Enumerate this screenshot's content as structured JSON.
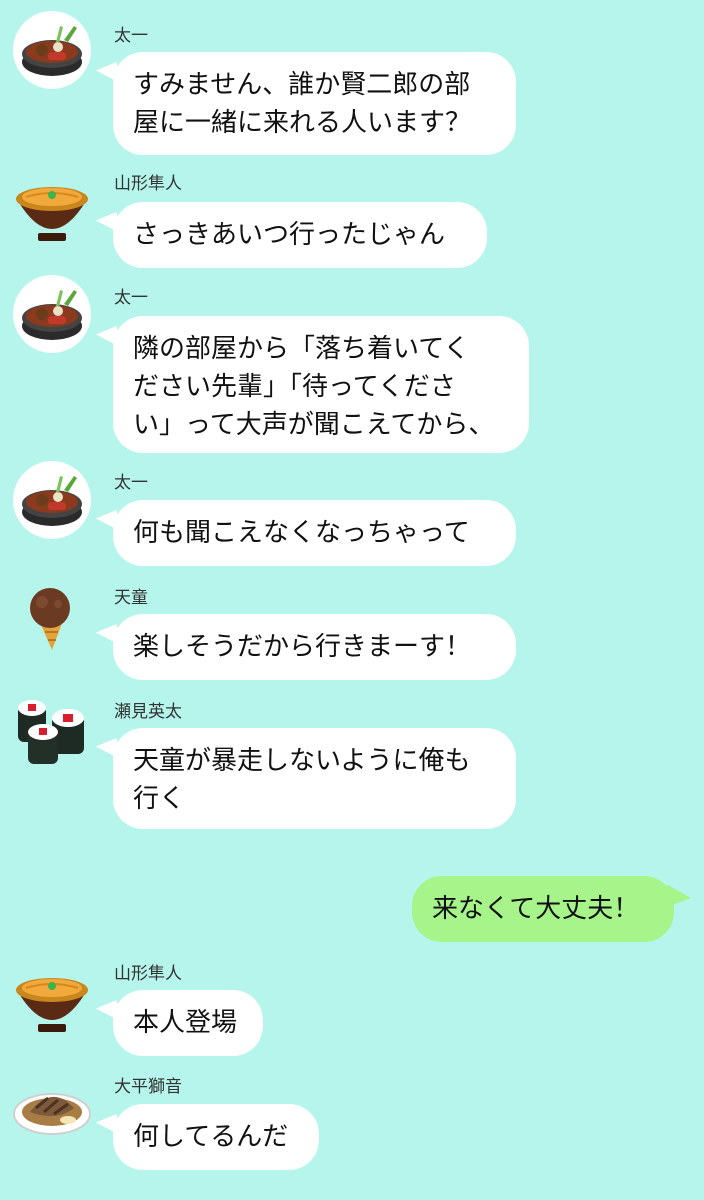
{
  "chat": {
    "m1": {
      "sender": "太一",
      "avatar": "sukiyaki-pot-icon",
      "text": "すみません、誰か賢二郎の部\n屋に一緒に来れる人います？"
    },
    "m2": {
      "sender": "山形隼人",
      "avatar": "uni-don-icon",
      "text": "さっきあいつ行ったじゃん"
    },
    "m3": {
      "sender": "太一",
      "avatar": "sukiyaki-pot-icon",
      "text": "隣の部屋から「落ち着いてく\nださい先輩」「待ってくださ\nい」って大声が聞こえてから、"
    },
    "m4": {
      "sender": "太一",
      "avatar": "sukiyaki-pot-icon",
      "text": "何も聞こえなくなっちゃって"
    },
    "m5": {
      "sender": "天童",
      "avatar": "chocolate-ice-cream-cone-icon",
      "text": "楽しそうだから行きまーす！"
    },
    "m6": {
      "sender": "瀬見英太",
      "avatar": "tekka-maki-icon",
      "text": "天童が暴走しないように俺も\n行く"
    },
    "m7": {
      "sender": "",
      "avatar": "",
      "text": "来なくて大丈夫！"
    },
    "m8": {
      "sender": "山形隼人",
      "avatar": "uni-don-icon",
      "text": "本人登場"
    },
    "m9": {
      "sender": "大平獅音",
      "avatar": "saba-miso-plate-icon",
      "text": "何してるんだ"
    }
  },
  "colors": {
    "background": "#b5f5ec",
    "incoming_bubble": "#ffffff",
    "outgoing_bubble": "#a6f48a"
  }
}
